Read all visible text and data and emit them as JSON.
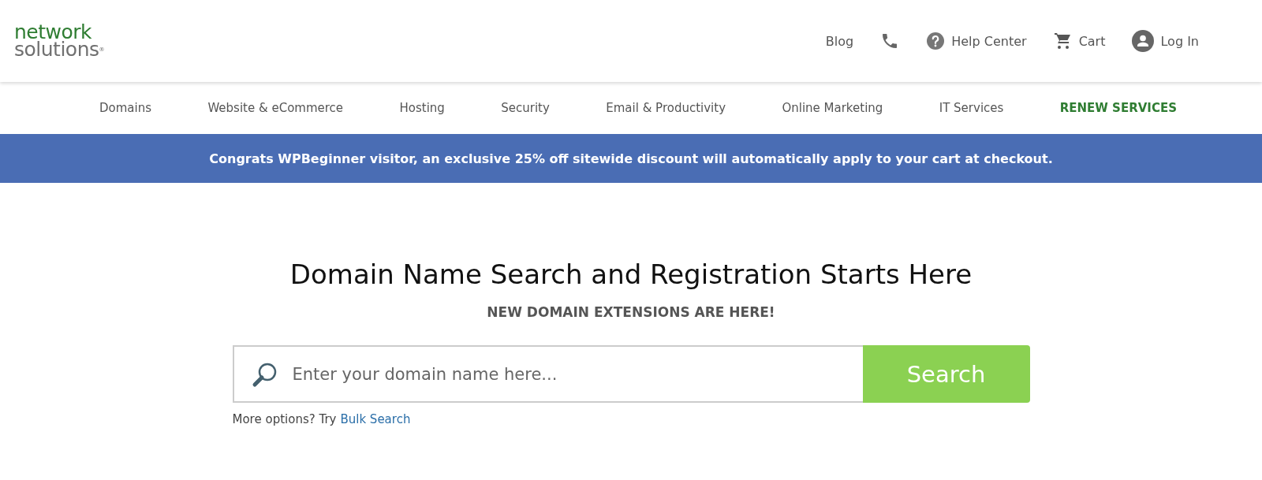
{
  "logo": {
    "top": "network",
    "bottom": "solutions",
    "mark": "®"
  },
  "header_links": [
    {
      "kind": "text",
      "label": "Blog"
    },
    {
      "kind": "phone"
    },
    {
      "kind": "help",
      "label": "Help Center"
    },
    {
      "kind": "cart",
      "label": "Cart"
    },
    {
      "kind": "account",
      "label": "Log In"
    }
  ],
  "nav": [
    {
      "kind": "normal",
      "label": "Domains"
    },
    {
      "kind": "normal",
      "label": "Website & eCommerce"
    },
    {
      "kind": "normal",
      "label": "Hosting"
    },
    {
      "kind": "normal",
      "label": "Security"
    },
    {
      "kind": "normal",
      "label": "Email & Productivity"
    },
    {
      "kind": "normal",
      "label": "Online Marketing"
    },
    {
      "kind": "normal",
      "label": "IT Services"
    },
    {
      "kind": "highlight",
      "label": "RENEW SERVICES"
    }
  ],
  "banner": "Congrats WPBeginner visitor, an exclusive 25% off sitewide discount will automatically apply to your cart at checkout.",
  "hero": {
    "title": "Domain Name Search and Registration Starts Here",
    "subtitle": "NEW DOMAIN EXTENSIONS ARE HERE!"
  },
  "search": {
    "placeholder": "Enter your domain name here...",
    "button": "Search"
  },
  "more_options": {
    "text": "More options? Try",
    "link": "Bulk Search"
  }
}
